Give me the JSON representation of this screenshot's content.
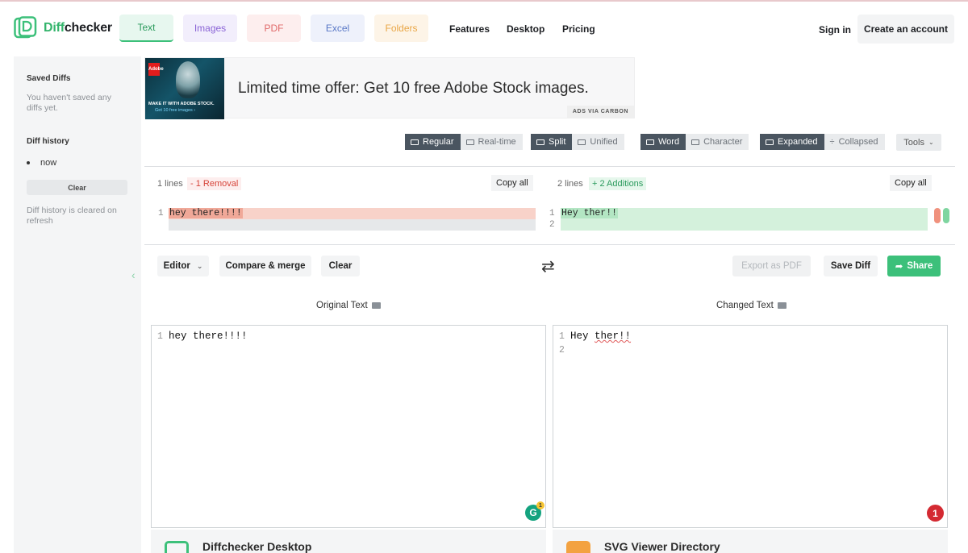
{
  "header": {
    "logo_part1": "Diff",
    "logo_part2": "checker",
    "tabs": [
      "Text",
      "Images",
      "PDF",
      "Excel",
      "Folders"
    ],
    "nav": [
      "Features",
      "Desktop",
      "Pricing"
    ],
    "sign_in": "Sign in",
    "create_account": "Create an account"
  },
  "sidebar": {
    "saved_title": "Saved Diffs",
    "saved_empty": "You haven't saved any diffs yet.",
    "history_title": "Diff history",
    "history_item": "now",
    "clear": "Clear",
    "cleared_note": "Diff history is cleared on refresh"
  },
  "ad": {
    "headline": "Limited time offer: Get 10 free Adobe Stock images.",
    "via": "ADS VIA CARBON",
    "image_caption": "MAKE IT WITH ADOBE STOCK.",
    "image_cta": "Get 10 free images ›",
    "brand": "Adobe"
  },
  "toolbar": {
    "mode": {
      "a": "Regular",
      "b": "Real-time"
    },
    "layout": {
      "a": "Split",
      "b": "Unified"
    },
    "granularity": {
      "a": "Word",
      "b": "Character"
    },
    "view": {
      "a": "Expanded",
      "b": "Collapsed"
    },
    "tools": "Tools"
  },
  "diff": {
    "left_lines": "1 lines",
    "removals": "- 1 Removal",
    "right_lines": "2 lines",
    "additions": "+ 2 Additions",
    "copy_all": "Copy all",
    "left_line_numbers": [
      "1"
    ],
    "left_text": "hey there!!!!",
    "right_line_numbers": [
      "1",
      "2"
    ],
    "right_text": "Hey ther!!"
  },
  "actions": {
    "editor": "Editor",
    "compare_merge": "Compare & merge",
    "clear": "Clear",
    "export_pdf": "Export as PDF",
    "save_diff": "Save Diff",
    "share": "Share"
  },
  "editors": {
    "original_title": "Original Text",
    "changed_title": "Changed Text",
    "original_lines": [
      "1"
    ],
    "original_text": "hey there!!!!",
    "changed_lines": [
      "1",
      "2"
    ],
    "changed_word1": "Hey",
    "changed_word2": "ther!!",
    "grammarly_count": "1",
    "error_count": "1"
  },
  "promos": {
    "left": "Diffchecker Desktop",
    "right": "SVG Viewer Directory"
  },
  "colors": {
    "brand_green": "#3cc07a",
    "removal_bg": "#f7c3b8",
    "addition_bg": "#cdeed8",
    "toggle_on": "#4a5560"
  }
}
